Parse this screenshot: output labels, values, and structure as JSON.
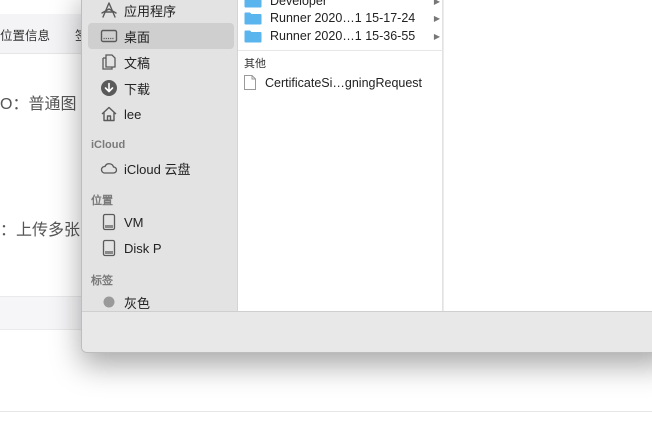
{
  "background_page": {
    "tab_location_info": "位置信息",
    "tab_partial": "签",
    "line_1": "O：普通图",
    "line_2": "：上传多张"
  },
  "sidebar": {
    "top_items": [
      {
        "label": "应用程序",
        "icon": "applications-icon"
      },
      {
        "label": "桌面",
        "icon": "desktop-icon",
        "selected": true
      },
      {
        "label": "文稿",
        "icon": "documents-icon"
      },
      {
        "label": "下载",
        "icon": "downloads-icon"
      },
      {
        "label": "lee",
        "icon": "home-icon"
      }
    ],
    "icloud_header": "iCloud",
    "icloud_items": [
      {
        "label": "iCloud 云盘",
        "icon": "cloud-icon"
      }
    ],
    "locations_header": "位置",
    "location_items": [
      {
        "label": "VM",
        "icon": "disk-icon"
      },
      {
        "label": "Disk P",
        "icon": "disk-icon"
      }
    ],
    "tags_header": "标签",
    "tag_items": [
      {
        "label": "灰色",
        "color": "#9a9a9a"
      }
    ]
  },
  "browser": {
    "folders": [
      {
        "label": "Developer"
      },
      {
        "label": "Runner 2020…1 15-17-24"
      },
      {
        "label": "Runner 2020…1 15-36-55"
      }
    ],
    "other_section_label": "其他",
    "files": [
      {
        "label": "CertificateSi…gningRequest"
      }
    ],
    "folder_color": "#5ab4ee"
  }
}
